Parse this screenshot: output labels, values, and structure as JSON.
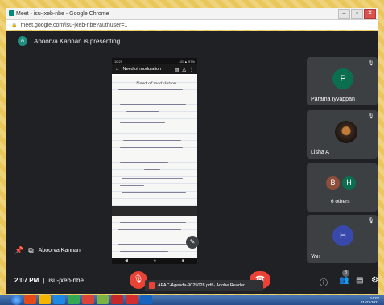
{
  "browser": {
    "title": "Meet - isu-jxeb-nbe - Google Chrome",
    "url": "meet.google.com/isu-jxeb-nbe?authuser=1"
  },
  "meeting": {
    "presenting_text": "Aboorva Kannan is presenting",
    "presenter_initial": "A",
    "presenter_name": "Aboorva Kannan",
    "time": "2:07 PM",
    "meeting_code": "isu-jxeb-nbe",
    "participant_badge": "8"
  },
  "shared_screen": {
    "phone_time": "10:21",
    "phone_status": "4G ▲ 97%",
    "doc_title": "Need of modulation",
    "page_heading": "Need of modulation"
  },
  "participants": [
    {
      "name": "Parama Iyyappan",
      "initial": "P",
      "color": "#0b6e4f"
    },
    {
      "name": "Lisha A",
      "initial": ""
    },
    {
      "name": "6 others",
      "initials": [
        "B",
        "H"
      ],
      "colors": [
        "#8d4e3a",
        "#0b6e4f"
      ]
    },
    {
      "name": "You",
      "initial": "H",
      "color": "#3949ab"
    }
  ],
  "download": {
    "filename": "APAC-Agenda-9025028.pdf - Adobe Reader"
  },
  "taskbar": {
    "clock": "14:07",
    "date": "31-01-2021"
  }
}
